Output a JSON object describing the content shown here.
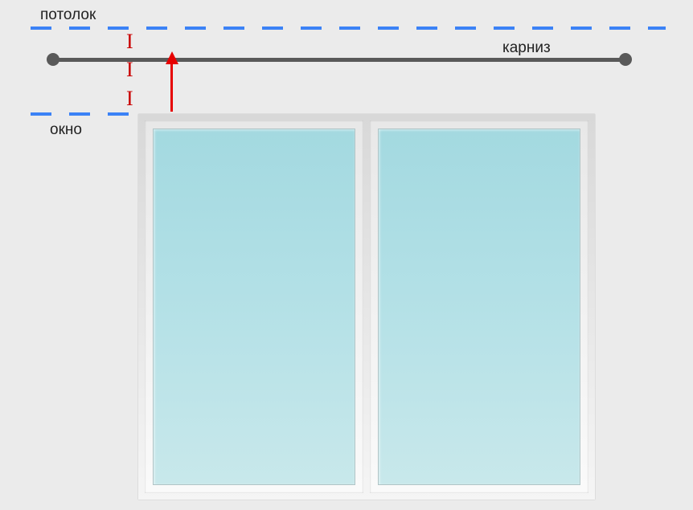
{
  "labels": {
    "ceiling": "потолок",
    "window": "окно",
    "cornice": "карниз"
  },
  "marks": {
    "third1": "I",
    "third2": "I",
    "third3": "I"
  },
  "diagram": {
    "description": "Curtain rod (карниз) placement relative to ceiling (потолок) and window (окно), divided into thirds",
    "colors": {
      "dashed_line": "#3b82f6",
      "rod": "#595959",
      "marks": "#c90000",
      "arrow": "#e60000"
    }
  }
}
